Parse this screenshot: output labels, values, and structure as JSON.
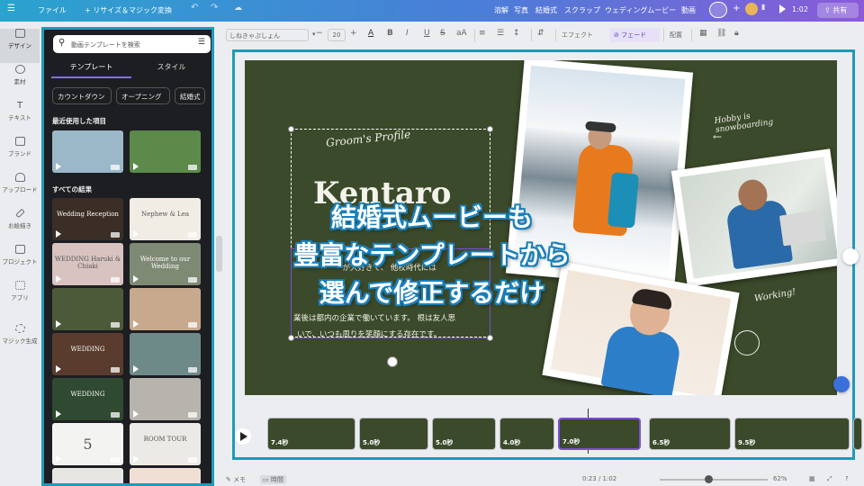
{
  "topbar": {
    "menu_icon": "hamburger-icon",
    "file_label": "ファイル",
    "resize_label": "+ リサイズ＆マジック変換",
    "nav_links": [
      "溶解",
      "写真",
      "結婚式",
      "スクラップ",
      "ウェディングムービー",
      "動画"
    ],
    "time": "1:02",
    "share_label": "共有",
    "add_label": "+"
  },
  "iconrail": {
    "items": [
      {
        "label": "デザイン",
        "icon": "layout-icon"
      },
      {
        "label": "素材",
        "icon": "shapes-icon"
      },
      {
        "label": "テキスト",
        "icon": "text-icon"
      },
      {
        "label": "ブランド",
        "icon": "brand-icon"
      },
      {
        "label": "アップロード",
        "icon": "upload-icon"
      },
      {
        "label": "お絵描き",
        "icon": "draw-icon"
      },
      {
        "label": "プロジェクト",
        "icon": "folder-icon"
      },
      {
        "label": "アプリ",
        "icon": "apps-icon"
      },
      {
        "label": "マジック生成",
        "icon": "magic-icon"
      }
    ]
  },
  "panel": {
    "search_placeholder": "動画テンプレートを検索",
    "tabs": [
      "テンプレート",
      "スタイル"
    ],
    "chips": [
      "カウントダウン",
      "オープニング",
      "結婚式"
    ],
    "recent_title": "最近使用した項目",
    "results_title": "すべての結果",
    "thumbs": [
      {
        "text": "",
        "bg": "#9ab8c8"
      },
      {
        "text": "",
        "bg": "#5c8a4a"
      },
      {
        "text": "Wedding Reception",
        "bg": "#3a2e26"
      },
      {
        "text": "Nephew & Lea",
        "bg": "#f1ece4"
      },
      {
        "text": "WEDDING Haruki & Chiaki",
        "bg": "#d9c3c0"
      },
      {
        "text": "Welcome to our Wedding",
        "bg": "#7f8a74"
      },
      {
        "text": "",
        "bg": "#4c5a3a"
      },
      {
        "text": "",
        "bg": "#c7a98e"
      },
      {
        "text": "WEDDING",
        "bg": "#5a3c2e"
      },
      {
        "text": "",
        "bg": "#6e8a88"
      },
      {
        "text": "WEDDING",
        "bg": "#2f4a30"
      },
      {
        "text": "",
        "bg": "#b7b4ad"
      },
      {
        "text": "5",
        "bg": "#f3f3f1"
      },
      {
        "text": "ROOM TOUR",
        "bg": "#eceae6"
      },
      {
        "text": "",
        "bg": "#e8e6e2"
      },
      {
        "text": "",
        "bg": "#f0e0d4"
      }
    ]
  },
  "toolbar": {
    "font": "しねきゃぷしょん",
    "size": "20",
    "effect_label": "エフェクト",
    "fade_label": "フェード",
    "align_label": "配置"
  },
  "slide": {
    "script_title": "Groom's Profile",
    "name": "Kentaro",
    "body_line1": "業後は都内の企業で働いています。 根は友人思",
    "body_line2": "いで、いつも周りを笑顔にする存在です。",
    "body_partial": "ーが大好きで、 他校時代には",
    "hobby_note": "Hobby is snowboarding",
    "working_note": "Working!"
  },
  "overlay": {
    "line1": "結婚式ムービーも",
    "line2": "豊富なテンプレートから",
    "line3": "選んで修正するだけ"
  },
  "timeline": {
    "play_icon": "play-icon",
    "clips": [
      {
        "dur": "7.4秒"
      },
      {
        "dur": "5.0秒"
      },
      {
        "dur": "5.0秒"
      },
      {
        "dur": "4.0秒"
      },
      {
        "dur": "7.0秒"
      },
      {
        "dur": "6.5秒"
      },
      {
        "dur": "9.5秒"
      },
      {
        "dur": ""
      }
    ]
  },
  "bottombar": {
    "memo_label": "メモ",
    "time_label": "時間",
    "position": "0:23 / 1:02",
    "zoom": "62%"
  }
}
